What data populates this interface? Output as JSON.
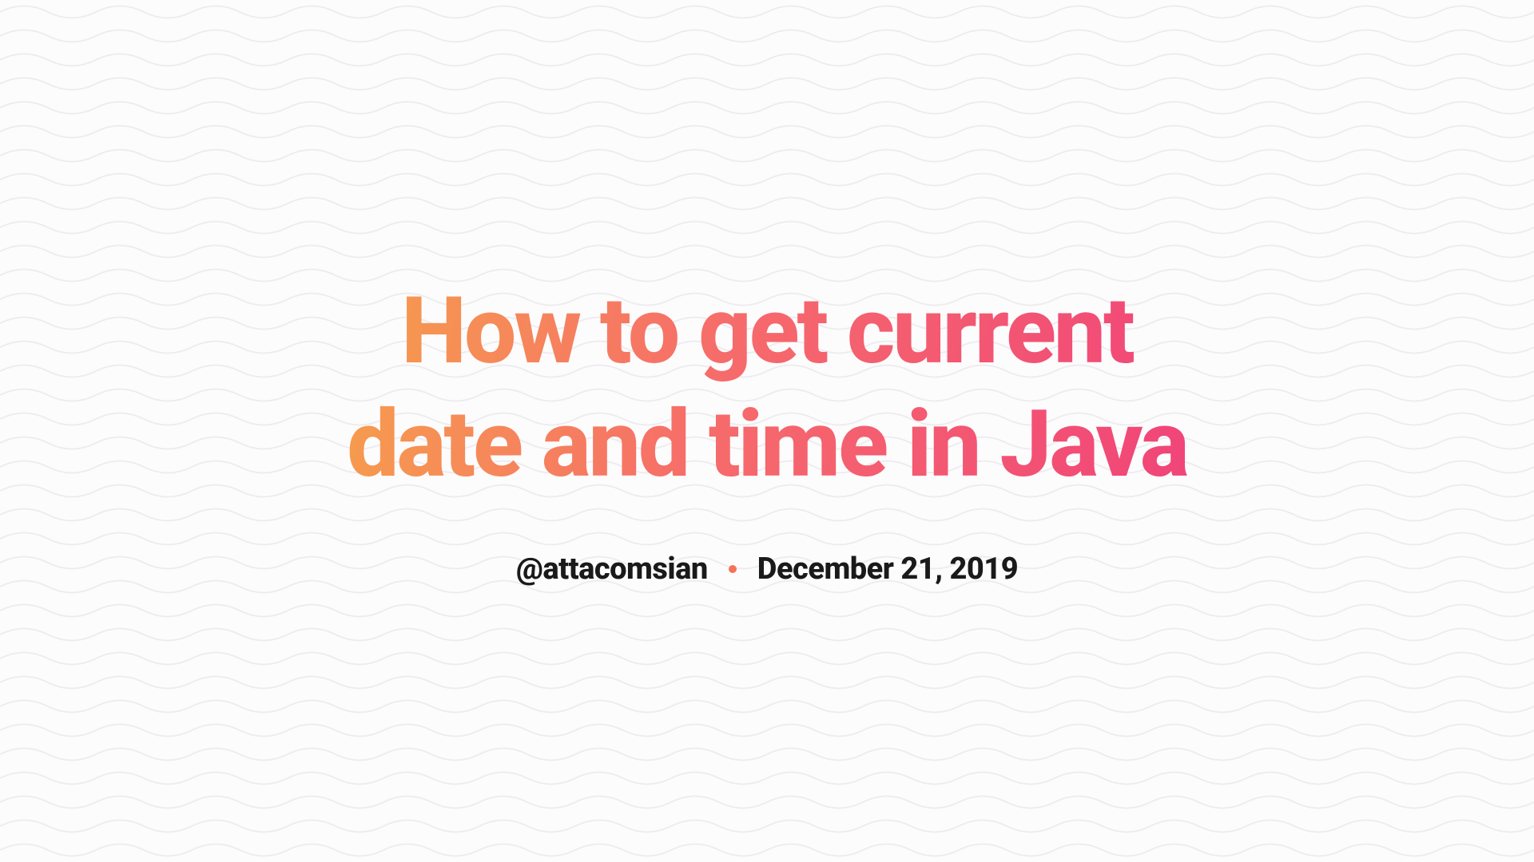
{
  "article": {
    "title": "How to get current date and time in Java",
    "author_handle": "@attacomsian",
    "date": "December 21, 2019"
  }
}
